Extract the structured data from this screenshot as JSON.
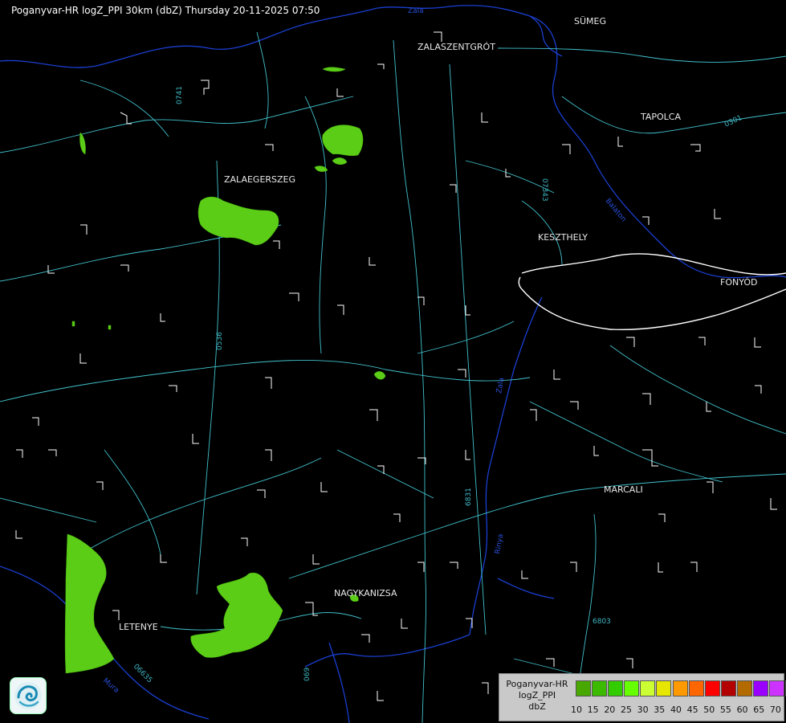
{
  "title": "Poganyvar-HR logZ_PPI 30km (dbZ) Thursday 20-11-2025 07:50",
  "cities": [
    {
      "name": "SÜMEG"
    },
    {
      "name": "ZALASZENTGRÓT"
    },
    {
      "name": "TAPOLCA"
    },
    {
      "name": "ZALAEGERSZEG"
    },
    {
      "name": "KESZTHELY"
    },
    {
      "name": "FONYÓD"
    },
    {
      "name": "MARCALI"
    },
    {
      "name": "NAGYKANIZSA"
    },
    {
      "name": "LETENYE"
    }
  ],
  "road_labels": [
    "0741",
    "07343",
    "0301",
    "0536",
    "6831",
    "6803",
    "06635",
    "069"
  ],
  "river_labels": [
    "Zala",
    "Zala",
    "Balaton",
    "Rinya",
    "Mura"
  ],
  "legend": {
    "line1": "Poganyvar-HR",
    "line2": "logZ_PPI",
    "line3": "dbZ",
    "colors": [
      "#48a800",
      "#3cba00",
      "#33cc00",
      "#66ff00",
      "#ccff33",
      "#e6e600",
      "#ff9900",
      "#ff6600",
      "#ff0000",
      "#b30000",
      "#b36b00",
      "#9900ff",
      "#cc33ff",
      "#aaaaff"
    ],
    "ticks": [
      "10",
      "15",
      "20",
      "25",
      "30",
      "35",
      "40",
      "45",
      "50",
      "55",
      "60",
      "65",
      "70"
    ]
  },
  "logo": {
    "icon": "weather-service-logo-icon"
  }
}
